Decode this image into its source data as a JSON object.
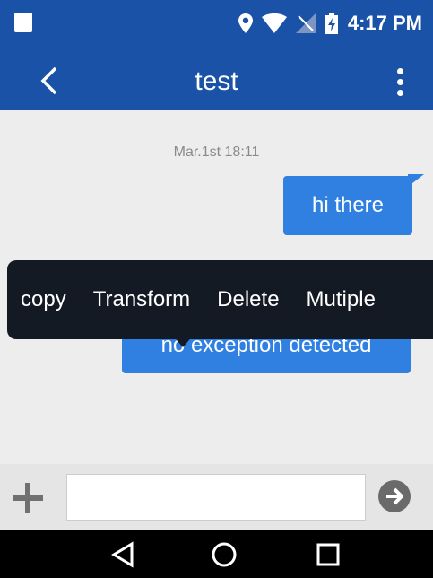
{
  "status_bar": {
    "time": "4:17 PM"
  },
  "app_bar": {
    "title": "test"
  },
  "chat": {
    "timestamp": "Mar.1st 18:11",
    "messages": [
      {
        "text": "hi there",
        "side": "outgoing"
      },
      {
        "text": "no exception detected",
        "side": "outgoing"
      }
    ]
  },
  "context_menu": {
    "items": [
      "copy",
      "Transform",
      "Delete",
      "Mutiple"
    ]
  },
  "composer": {
    "value": "",
    "placeholder": ""
  },
  "colors": {
    "primary": "#1a52a8",
    "bubble": "#2f80e0",
    "menu_bg": "#141a24",
    "background": "#ededed"
  },
  "icons": [
    "back-arrow-icon",
    "overflow-menu-icon",
    "plus-icon",
    "send-icon",
    "location-icon",
    "wifi-icon",
    "signal-icon",
    "battery-icon",
    "nav-back-icon",
    "nav-home-icon",
    "nav-recent-icon"
  ]
}
